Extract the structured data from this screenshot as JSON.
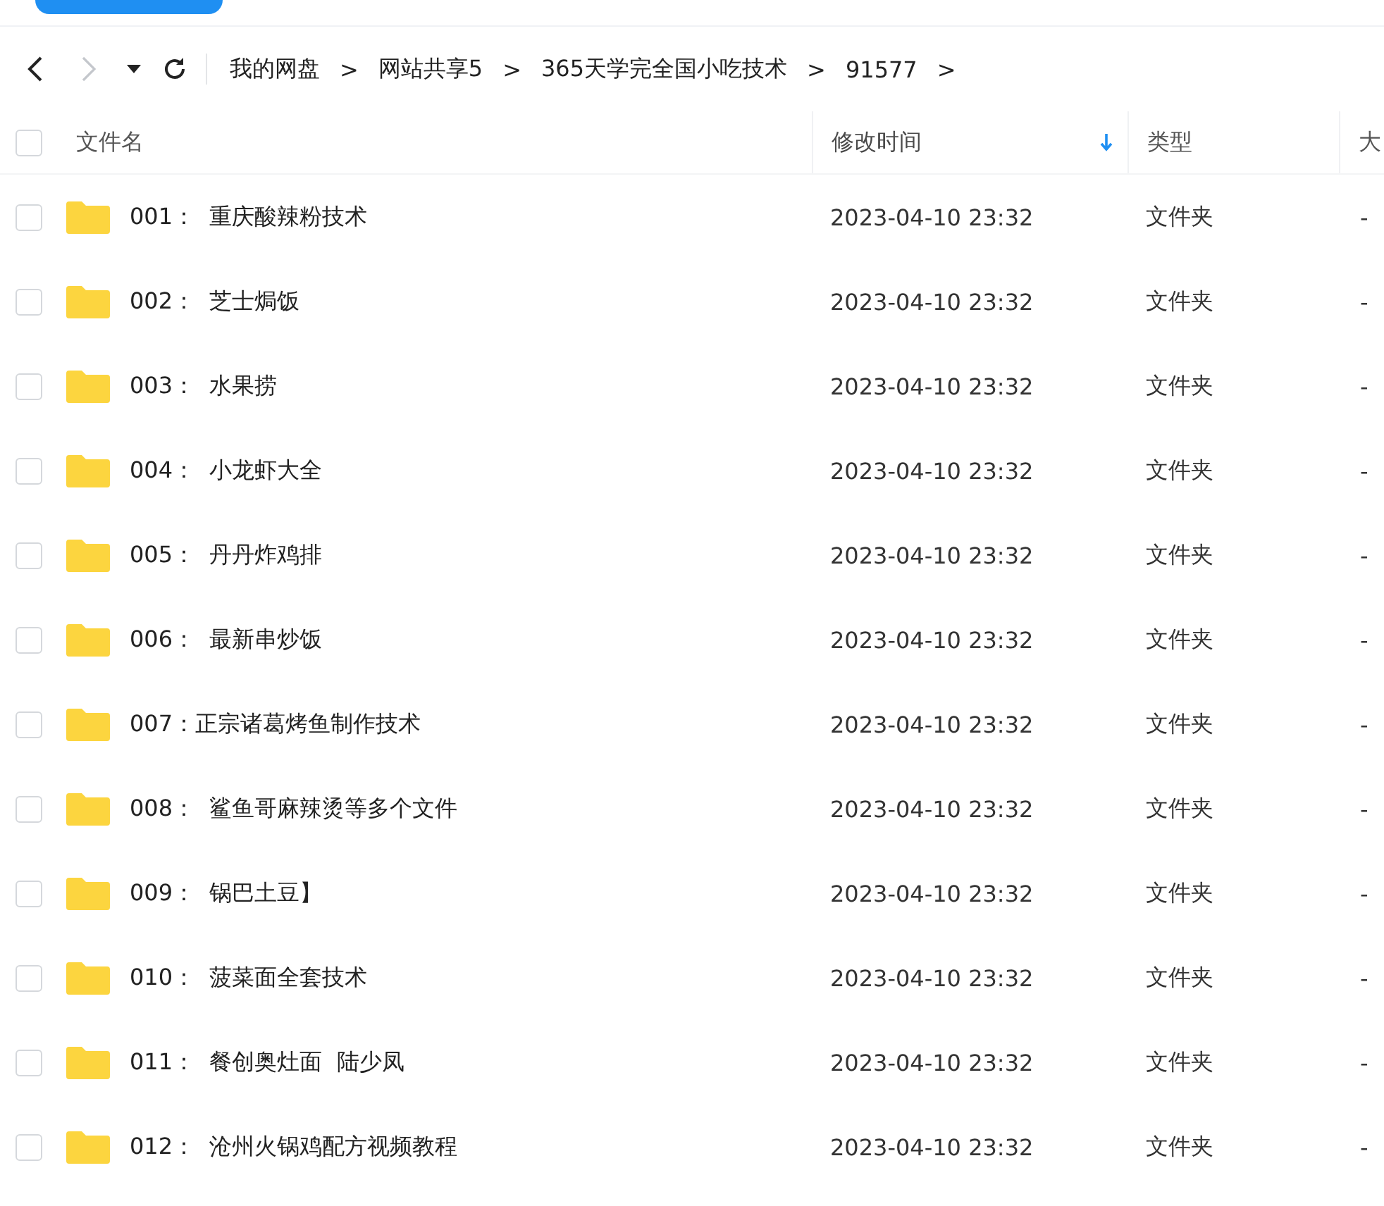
{
  "toolbar": {
    "back": {
      "disabled": false
    },
    "forward": {
      "disabled": true
    },
    "breadcrumb": [
      {
        "label": "我的网盘",
        "separator": ">"
      },
      {
        "label": "网站共享5",
        "separator": ">"
      },
      {
        "label": "365天学完全国小吃技术",
        "separator": ">"
      },
      {
        "label": "91577",
        "separator": ">"
      }
    ]
  },
  "table": {
    "select_all": {
      "checked": false
    },
    "columns": [
      {
        "label": "文件名",
        "sorted": false
      },
      {
        "label": "修改时间",
        "sorted": true
      },
      {
        "label": "类型",
        "sorted": false
      },
      {
        "label": "大",
        "sorted": false
      }
    ],
    "rows": [
      {
        "checked": false,
        "name": "001：  重庆酸辣粉技术",
        "modified": "2023-04-10 23:32",
        "type": "文件夹",
        "size": "-"
      },
      {
        "checked": false,
        "name": "002：  芝士焗饭",
        "modified": "2023-04-10 23:32",
        "type": "文件夹",
        "size": "-"
      },
      {
        "checked": false,
        "name": "003：  水果捞",
        "modified": "2023-04-10 23:32",
        "type": "文件夹",
        "size": "-"
      },
      {
        "checked": false,
        "name": "004：  小龙虾大全",
        "modified": "2023-04-10 23:32",
        "type": "文件夹",
        "size": "-"
      },
      {
        "checked": false,
        "name": "005：  丹丹炸鸡排",
        "modified": "2023-04-10 23:32",
        "type": "文件夹",
        "size": "-"
      },
      {
        "checked": false,
        "name": "006：  最新串炒饭",
        "modified": "2023-04-10 23:32",
        "type": "文件夹",
        "size": "-"
      },
      {
        "checked": false,
        "name": "007：正宗诸葛烤鱼制作技术",
        "modified": "2023-04-10 23:32",
        "type": "文件夹",
        "size": "-"
      },
      {
        "checked": false,
        "name": "008：  鲨鱼哥麻辣烫等多个文件",
        "modified": "2023-04-10 23:32",
        "type": "文件夹",
        "size": "-"
      },
      {
        "checked": false,
        "name": "009：  锅巴土豆】",
        "modified": "2023-04-10 23:32",
        "type": "文件夹",
        "size": "-"
      },
      {
        "checked": false,
        "name": "010：  菠菜面全套技术",
        "modified": "2023-04-10 23:32",
        "type": "文件夹",
        "size": "-"
      },
      {
        "checked": false,
        "name": "011：  餐创奥灶面  陆少凤",
        "modified": "2023-04-10 23:32",
        "type": "文件夹",
        "size": "-"
      },
      {
        "checked": false,
        "name": "012：  沧州火锅鸡配方视频教程",
        "modified": "2023-04-10 23:32",
        "type": "文件夹",
        "size": "-"
      }
    ]
  }
}
